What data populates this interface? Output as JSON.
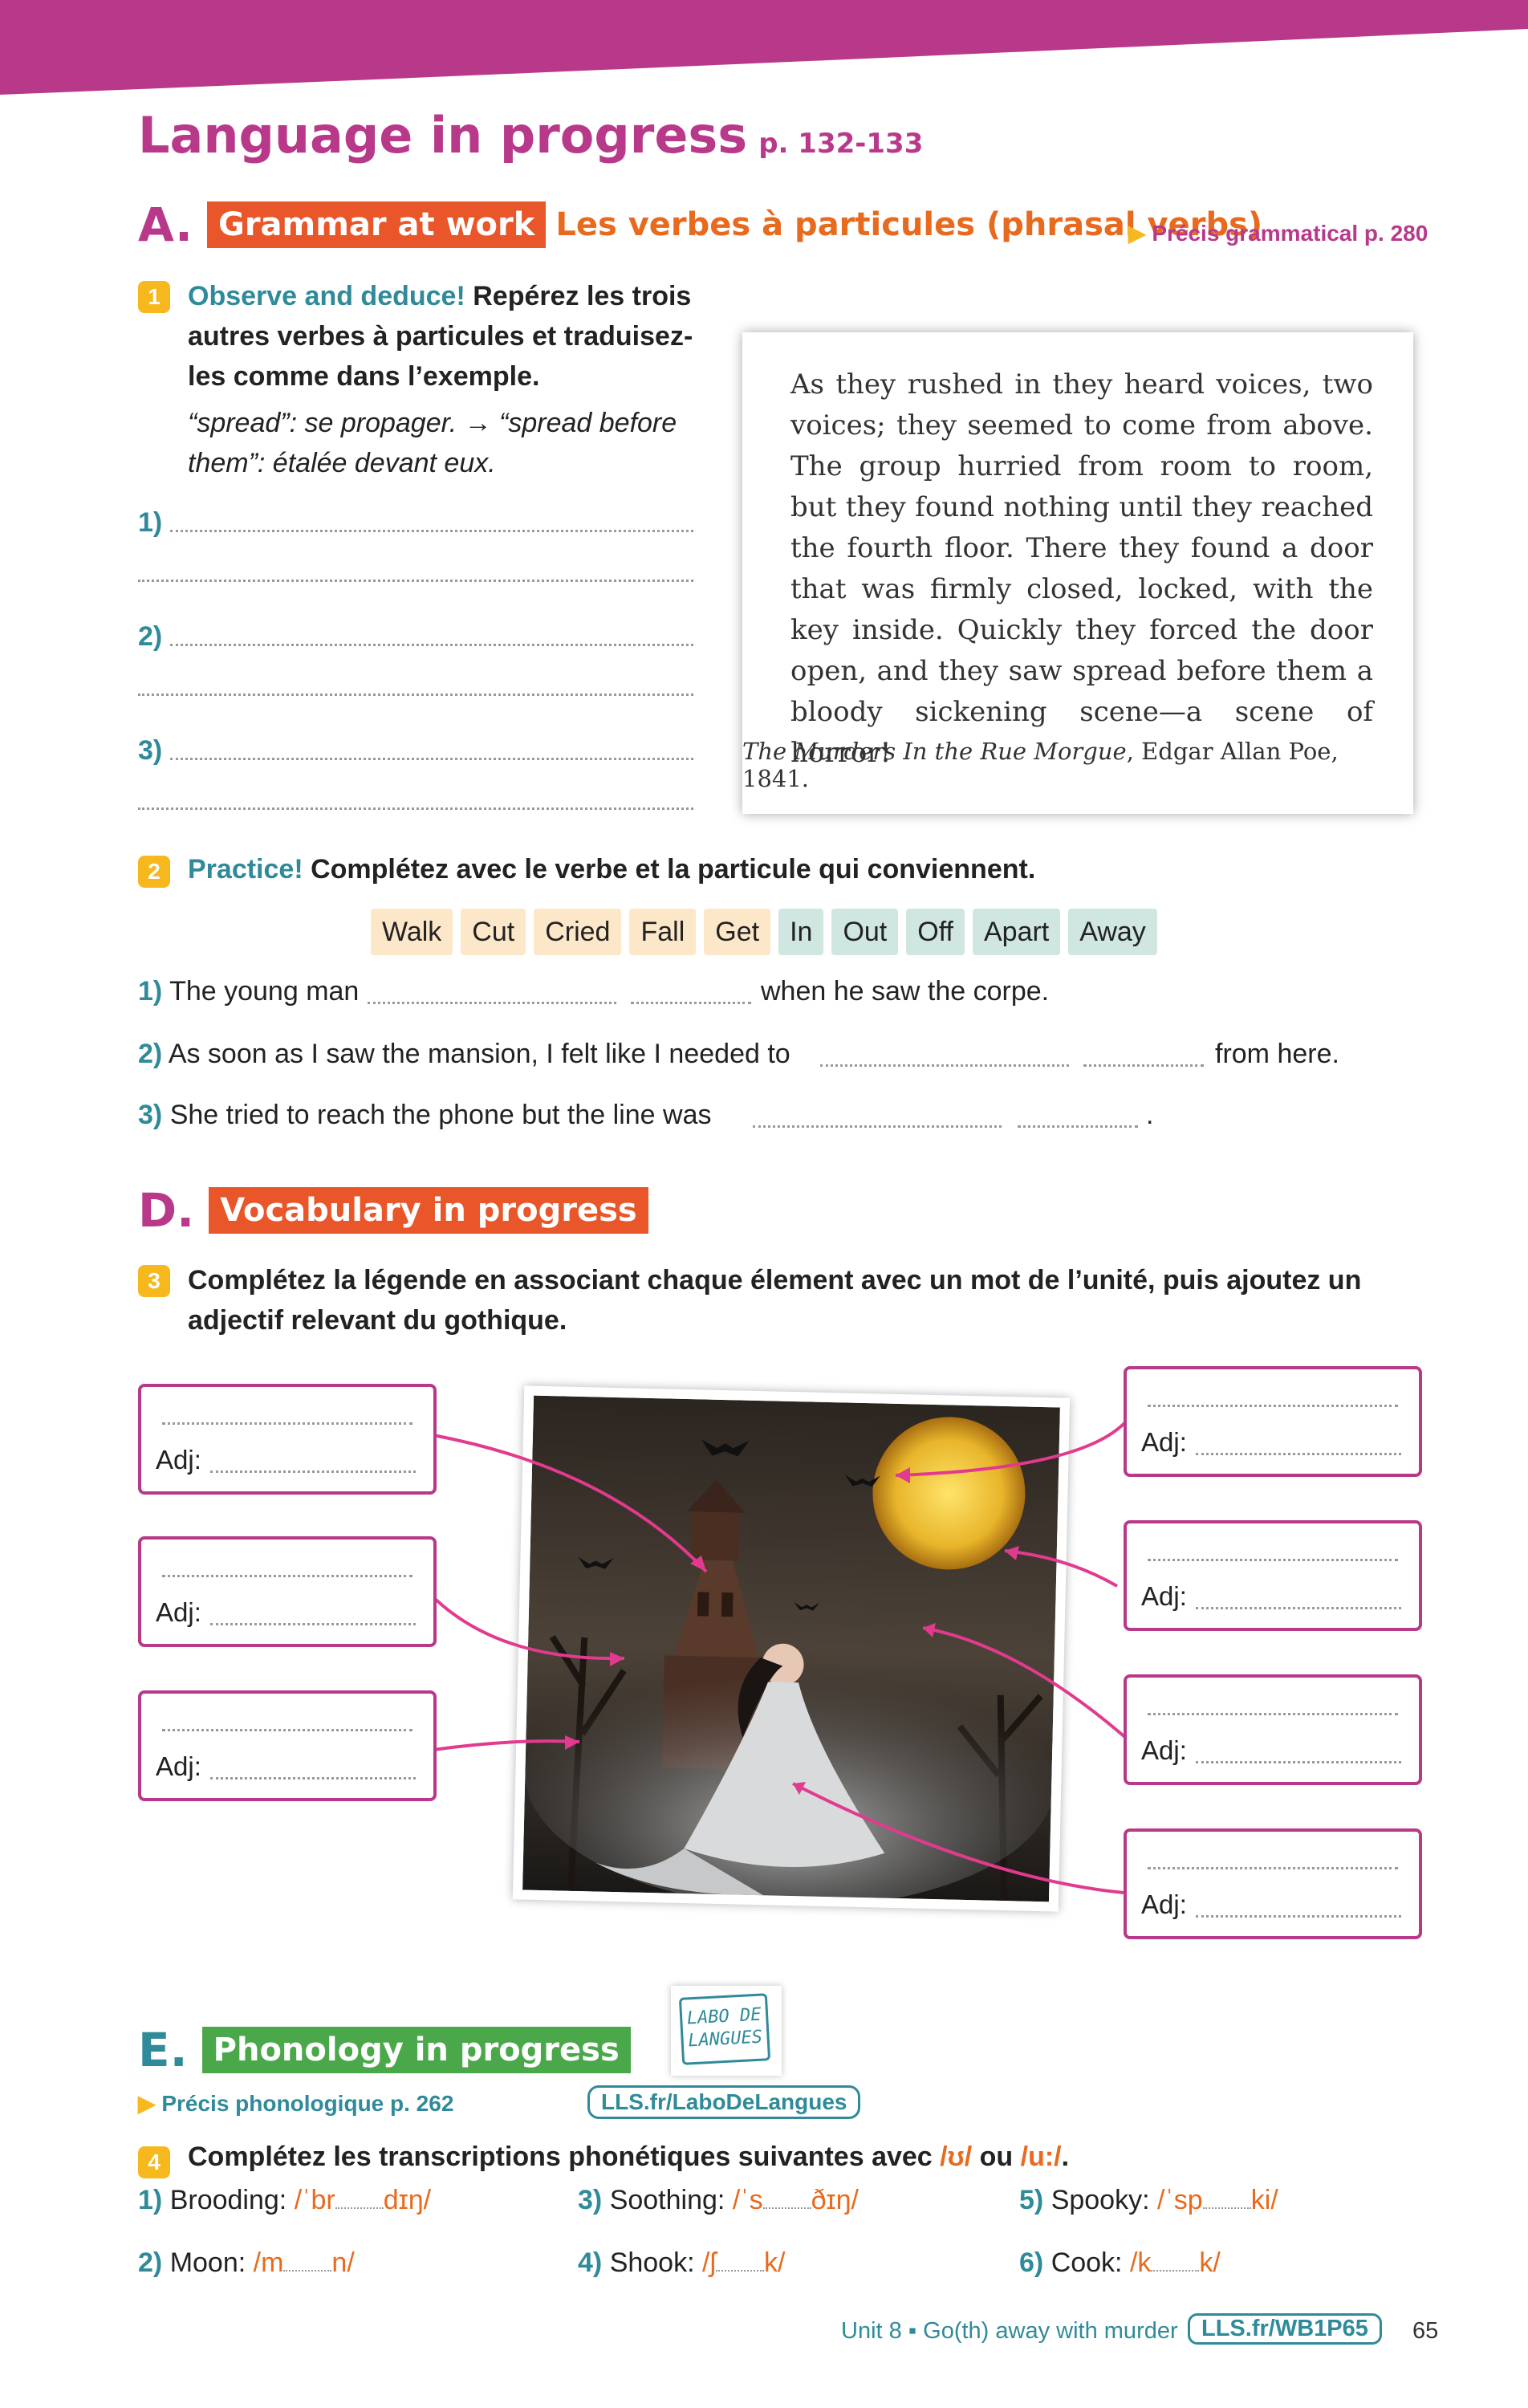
{
  "header": {
    "title": "Language in progress",
    "pages": "p. 132-133"
  },
  "sectionA": {
    "letter": "A.",
    "label": "Grammar at work",
    "subtitle": "Les verbes à particules (phrasal verbs)",
    "ref": "Précis grammatical p. 280"
  },
  "ex1": {
    "num": "1",
    "lead": "Observe and deduce!",
    "instr1": " Repérez les trois",
    "instr2": "autres verbes à particules et traduisez-",
    "instr3": "les comme dans l’exemple.",
    "ex_line1": "“spread”: se propager. → “spread before",
    "ex_line2": "them”: étalée devant eux.",
    "items": [
      "1)",
      "2)",
      "3)"
    ]
  },
  "quote": {
    "text": "As they rushed in they heard voices, two voices; they seemed to come from above. The group hurried from room to room, but they found nothing until they reached the fourth floor. There they found a door that was firmly closed, locked, with the key inside. Quickly they forced the door open, and they saw spread before them a bloody sickening scene—a scene of horror!",
    "source_title": "The Murders In the Rue Morgue",
    "source_rest": ", Edgar Allan Poe, 1841."
  },
  "ex2": {
    "num": "2",
    "lead": "Practice!",
    "instr": " Complétez avec le verbe et la particule qui conviennent.",
    "verbs": [
      "Walk",
      "Cut",
      "Cried",
      "Fall",
      "Get"
    ],
    "particles": [
      "In",
      "Out",
      "Off",
      "Apart",
      "Away"
    ],
    "s1": {
      "num": "1)",
      "a": "The young man",
      "b": "when he saw the corpe."
    },
    "s2": {
      "num": "2)",
      "a": "As soon as I saw the mansion, I felt like I needed to",
      "b": "from here."
    },
    "s3": {
      "num": "3)",
      "a": "She tried to reach the phone but the line was",
      "b": "."
    }
  },
  "sectionD": {
    "letter": "D.",
    "label": "Vocabulary in progress"
  },
  "ex3": {
    "num": "3",
    "instr1": "Complétez la légende en associant chaque élement avec un mot de l’unité, puis ajoutez un",
    "instr2": "adjectif relevant du gothique.",
    "adj_label": "Adj:"
  },
  "sectionE": {
    "letter": "E.",
    "label": "Phonology in progress",
    "ref": "Précis phonologique p. 262",
    "labo_logo": "LABO DE LANGUES",
    "labo_link": "LLS.fr/LaboDeLangues"
  },
  "ex4": {
    "num": "4",
    "instr": "Complétez les transcriptions phonétiques suivantes avec ",
    "sym1": "/ʊ/",
    "or": " ou ",
    "sym2": "/u:/",
    "end": ".",
    "words": [
      {
        "n": "1)",
        "w": "Brooding:",
        "a": "/ˈbr",
        "b": "dɪŋ/"
      },
      {
        "n": "2)",
        "w": "Moon:",
        "a": "/m",
        "b": "n/"
      },
      {
        "n": "3)",
        "w": "Soothing:",
        "a": "/ˈs",
        "b": "ðɪŋ/"
      },
      {
        "n": "4)",
        "w": "Shook:",
        "a": "/ʃ",
        "b": "k/"
      },
      {
        "n": "5)",
        "w": "Spooky:",
        "a": "/ˈsp",
        "b": "ki/"
      },
      {
        "n": "6)",
        "w": "Cook:",
        "a": "/k",
        "b": "k/"
      }
    ]
  },
  "footer": {
    "unit": "Unit 8 ▪ Go(th) away with murder",
    "link": "LLS.fr/WB1P65",
    "page": "65"
  },
  "colors": {
    "pink": "#b8398a",
    "teal": "#2f8a9a",
    "orange": "#e86a1e",
    "green": "#4aa84a",
    "yellow": "#f6b81c"
  }
}
